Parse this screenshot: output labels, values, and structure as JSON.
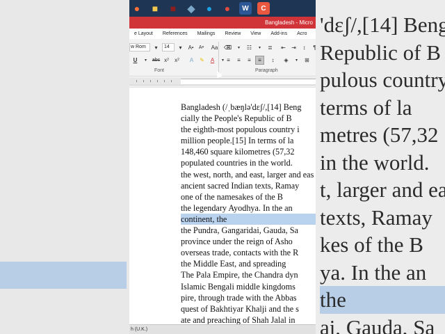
{
  "taskbar": {
    "icons": [
      {
        "name": "firefox-icon",
        "glyph": "●",
        "color": "#ff7139"
      },
      {
        "name": "file-explorer-icon",
        "glyph": "■",
        "color": "#f2c94c"
      },
      {
        "name": "app-icon",
        "glyph": "■",
        "color": "#8b1e1e"
      },
      {
        "name": "app-icon-2",
        "glyph": "◆",
        "color": "#7aa7c7"
      },
      {
        "name": "edge-icon",
        "glyph": "●",
        "color": "#1ba1e2"
      },
      {
        "name": "chrome-icon",
        "glyph": "●",
        "color": "#e04a3f"
      },
      {
        "name": "word-icon",
        "glyph": "W",
        "color": "#2b5797"
      },
      {
        "name": "office-icon",
        "glyph": "C",
        "color": "#e9573f"
      }
    ]
  },
  "window": {
    "title": "Bangladesh - Micro"
  },
  "ribbon": {
    "tabs": [
      "e Layout",
      "References",
      "Mailings",
      "Review",
      "View",
      "Add-ins",
      "Acro"
    ],
    "font_name": "w Rom",
    "font_size": "14",
    "font_group": "Font",
    "paragraph_group": "Paragraph"
  },
  "document": {
    "lines": [
      {
        "text": "Bangladesh (/ˌbæŋlə'dɛʃ/,[14] Beng",
        "hl": false
      },
      {
        "text": "cially the People's Republic of B",
        "hl": false
      },
      {
        "text": "the eighth-most populous country i",
        "hl": false
      },
      {
        "text": "million people.[15] In terms of la",
        "hl": false
      },
      {
        "text": "148,460 square kilometres (57,32",
        "hl": false
      },
      {
        "text": "populated countries in the world.",
        "hl": false
      },
      {
        "text": "the west, north, and east, larger and eas",
        "hl": false
      },
      {
        "text": "ancient sacred Indian texts, Ramay",
        "hl": false
      },
      {
        "text": "one of the namesakes of the B",
        "hl": false
      },
      {
        "text": "the legendary Ayodhya. In the an",
        "hl": false
      },
      {
        "text": "continent,            the",
        "hl": true
      },
      {
        "text": "the Pundra, Gangaridai, Gauda, Sa",
        "hl": false
      },
      {
        "text": "province under the reign of Asho",
        "hl": false
      },
      {
        "text": "overseas trade, contacts with the R",
        "hl": false
      },
      {
        "text": "the Middle East, and spreading",
        "hl": false
      },
      {
        "text": "The Pala Empire, the Chandra dyn",
        "hl": false
      },
      {
        "text": "Islamic Bengali middle kingdoms",
        "hl": false
      },
      {
        "text": "pire, through trade with the Abbas",
        "hl": false
      },
      {
        "text": "quest of Bakhtiyar Khalji and the s",
        "hl": false
      },
      {
        "text": "ate and preaching of Shah Jalal in",
        "hl": false
      }
    ]
  },
  "status": {
    "language": "h (U.K.)"
  },
  "background_left": {
    "lines": [
      "",
      "",
      "",
      "",
      "",
      "",
      "",
      "",
      "",
      "",
      "",
      "",
      ""
    ]
  },
  "background_right": {
    "lines": [
      {
        "text": "'dɛʃ/,[14] Beng",
        "hl": false
      },
      {
        "text": "Republic of B",
        "hl": false
      },
      {
        "text": "pulous country i",
        "hl": false
      },
      {
        "text": "terms of la",
        "hl": false
      },
      {
        "text": "metres (57,32",
        "hl": false
      },
      {
        "text": "in the world.",
        "hl": false
      },
      {
        "text": "t, larger and eas",
        "hl": false
      },
      {
        "text": " texts, Ramay",
        "hl": false
      },
      {
        "text": "kes of the B",
        "hl": false
      },
      {
        "text": "ya. In the an",
        "hl": false
      },
      {
        "text": "        the",
        "hl": true
      },
      {
        "text": "ai, Gauda, Sa",
        "hl": false
      }
    ]
  }
}
